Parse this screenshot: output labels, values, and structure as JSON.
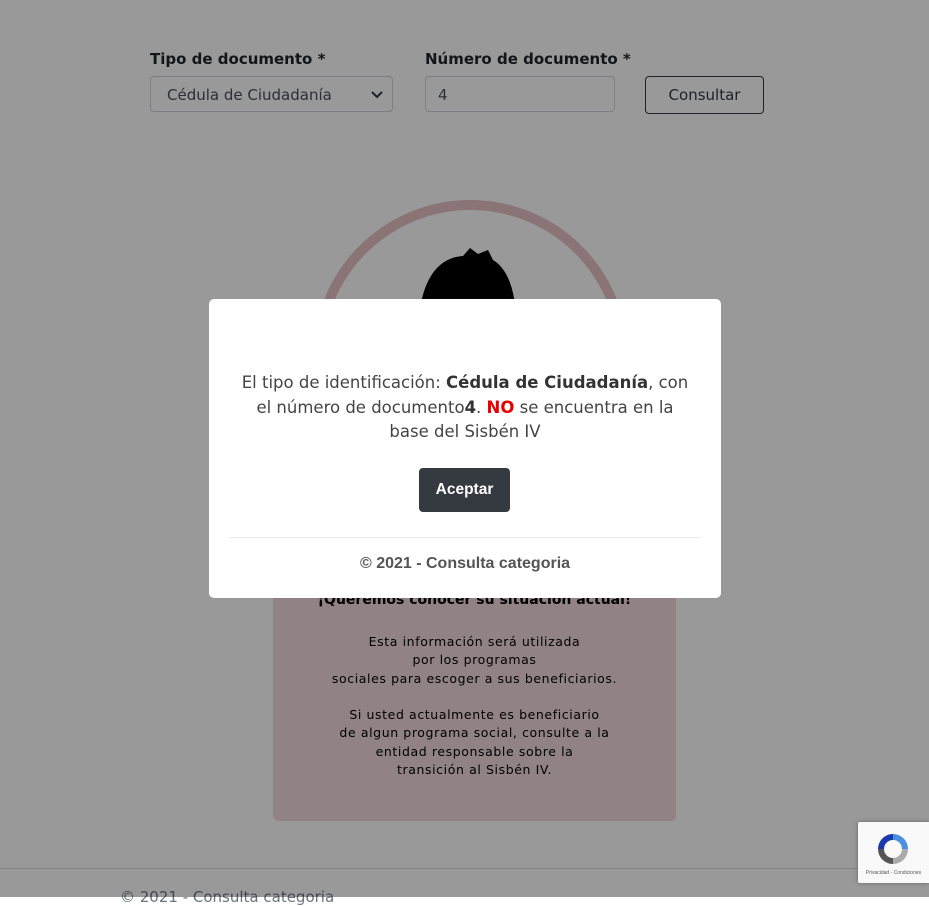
{
  "form": {
    "doc_type_label": "Tipo de documento *",
    "doc_type_value": "Cédula de Ciudadanía",
    "doc_number_label": "Número de documento *",
    "doc_number_value": "4",
    "consult_button": "Consultar"
  },
  "hero": {
    "image_icon": "person-silhouette-icon"
  },
  "info_card": {
    "title": "¡Queremos conocer su situación actual!",
    "para1": [
      "Esta información será utilizada",
      "por los programas",
      "sociales para escoger a sus beneficiarios."
    ],
    "para2": [
      "Si usted actualmente es beneficiario",
      "de algun programa social, consulte a la",
      "entidad responsable sobre la",
      "transición al Sisbén IV."
    ]
  },
  "footer": {
    "text": "© 2021 - Consulta categoria"
  },
  "modal": {
    "msg_prefix": "El tipo de identificación: ",
    "doc_type": "Cédula de Ciudadanía",
    "msg_middle": ", con el número de documento",
    "doc_number": "4",
    "msg_dot": ". ",
    "no_word": "NO",
    "msg_suffix": " se encuentra en la base del Sisbén IV",
    "accept_button": "Aceptar",
    "footer": "© 2021 - Consulta categoria"
  },
  "recaptcha": {
    "text": "Privacidad - Condiciones"
  },
  "colors": {
    "overlay": "rgba(0,0,0,0.4)",
    "no_highlight": "#e60000",
    "accept_button_bg": "#343a40",
    "card_bg": "#f2d9da"
  }
}
